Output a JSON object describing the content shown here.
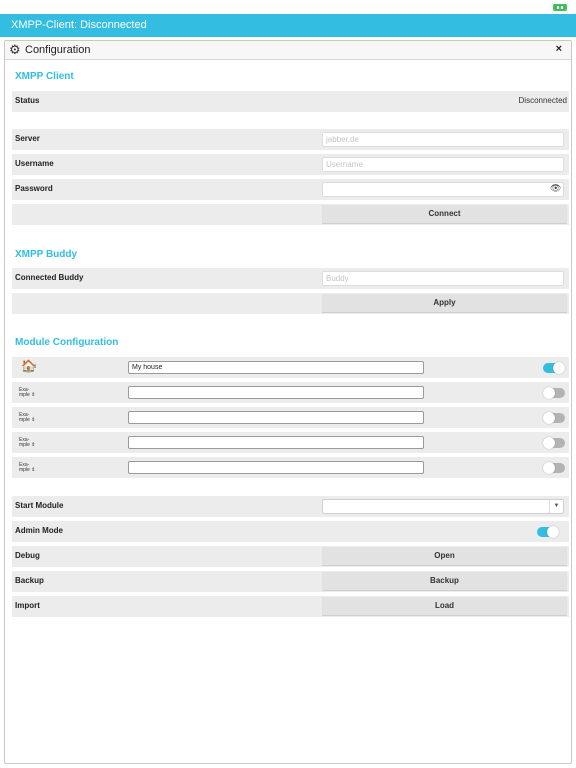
{
  "app": {
    "title": "XMPP-Client: Disconnected"
  },
  "panel": {
    "title": "Configuration",
    "close_label": "×",
    "icon": "gear-icon"
  },
  "xmpp_client": {
    "section_title": "XMPP Client",
    "status_label": "Status",
    "status_value": "Disconnected",
    "server_label": "Server",
    "server_placeholder": "jabber.de",
    "username_label": "Username",
    "username_placeholder": "Username",
    "password_label": "Password",
    "password_icon": "eye-icon",
    "connect_label": "Connect"
  },
  "xmpp_buddy": {
    "section_title": "XMPP Buddy",
    "buddy_label": "Connected Buddy",
    "buddy_placeholder": "Buddy",
    "apply_label": "Apply"
  },
  "module_config": {
    "section_title": "Module Configuration",
    "modules": [
      {
        "icon": "house-icon",
        "label_line1": "",
        "label_line2": "",
        "name": "My house",
        "enabled": true
      },
      {
        "icon": "",
        "label_line1": "Exa-",
        "label_line2": "mple ⇕",
        "name": "",
        "enabled": false
      },
      {
        "icon": "",
        "label_line1": "Exa-",
        "label_line2": "mple ⇕",
        "name": "",
        "enabled": false
      },
      {
        "icon": "",
        "label_line1": "Exa-",
        "label_line2": "mple ⇕",
        "name": "",
        "enabled": false
      },
      {
        "icon": "",
        "label_line1": "Exa-",
        "label_line2": "mple ⇕",
        "name": "",
        "enabled": false
      }
    ]
  },
  "settings": {
    "start_module_label": "Start Module",
    "start_module_value": "",
    "admin_mode_label": "Admin Mode",
    "admin_mode_on": true,
    "debug_label": "Debug",
    "debug_button": "Open",
    "backup_label": "Backup",
    "backup_button": "Backup",
    "import_label": "Import",
    "import_button": "Load"
  },
  "colors": {
    "accent": "#33bde0",
    "row_bg": "#ececec",
    "button_bg": "#e2e2e2",
    "toggle_off": "#b3b3b3"
  }
}
